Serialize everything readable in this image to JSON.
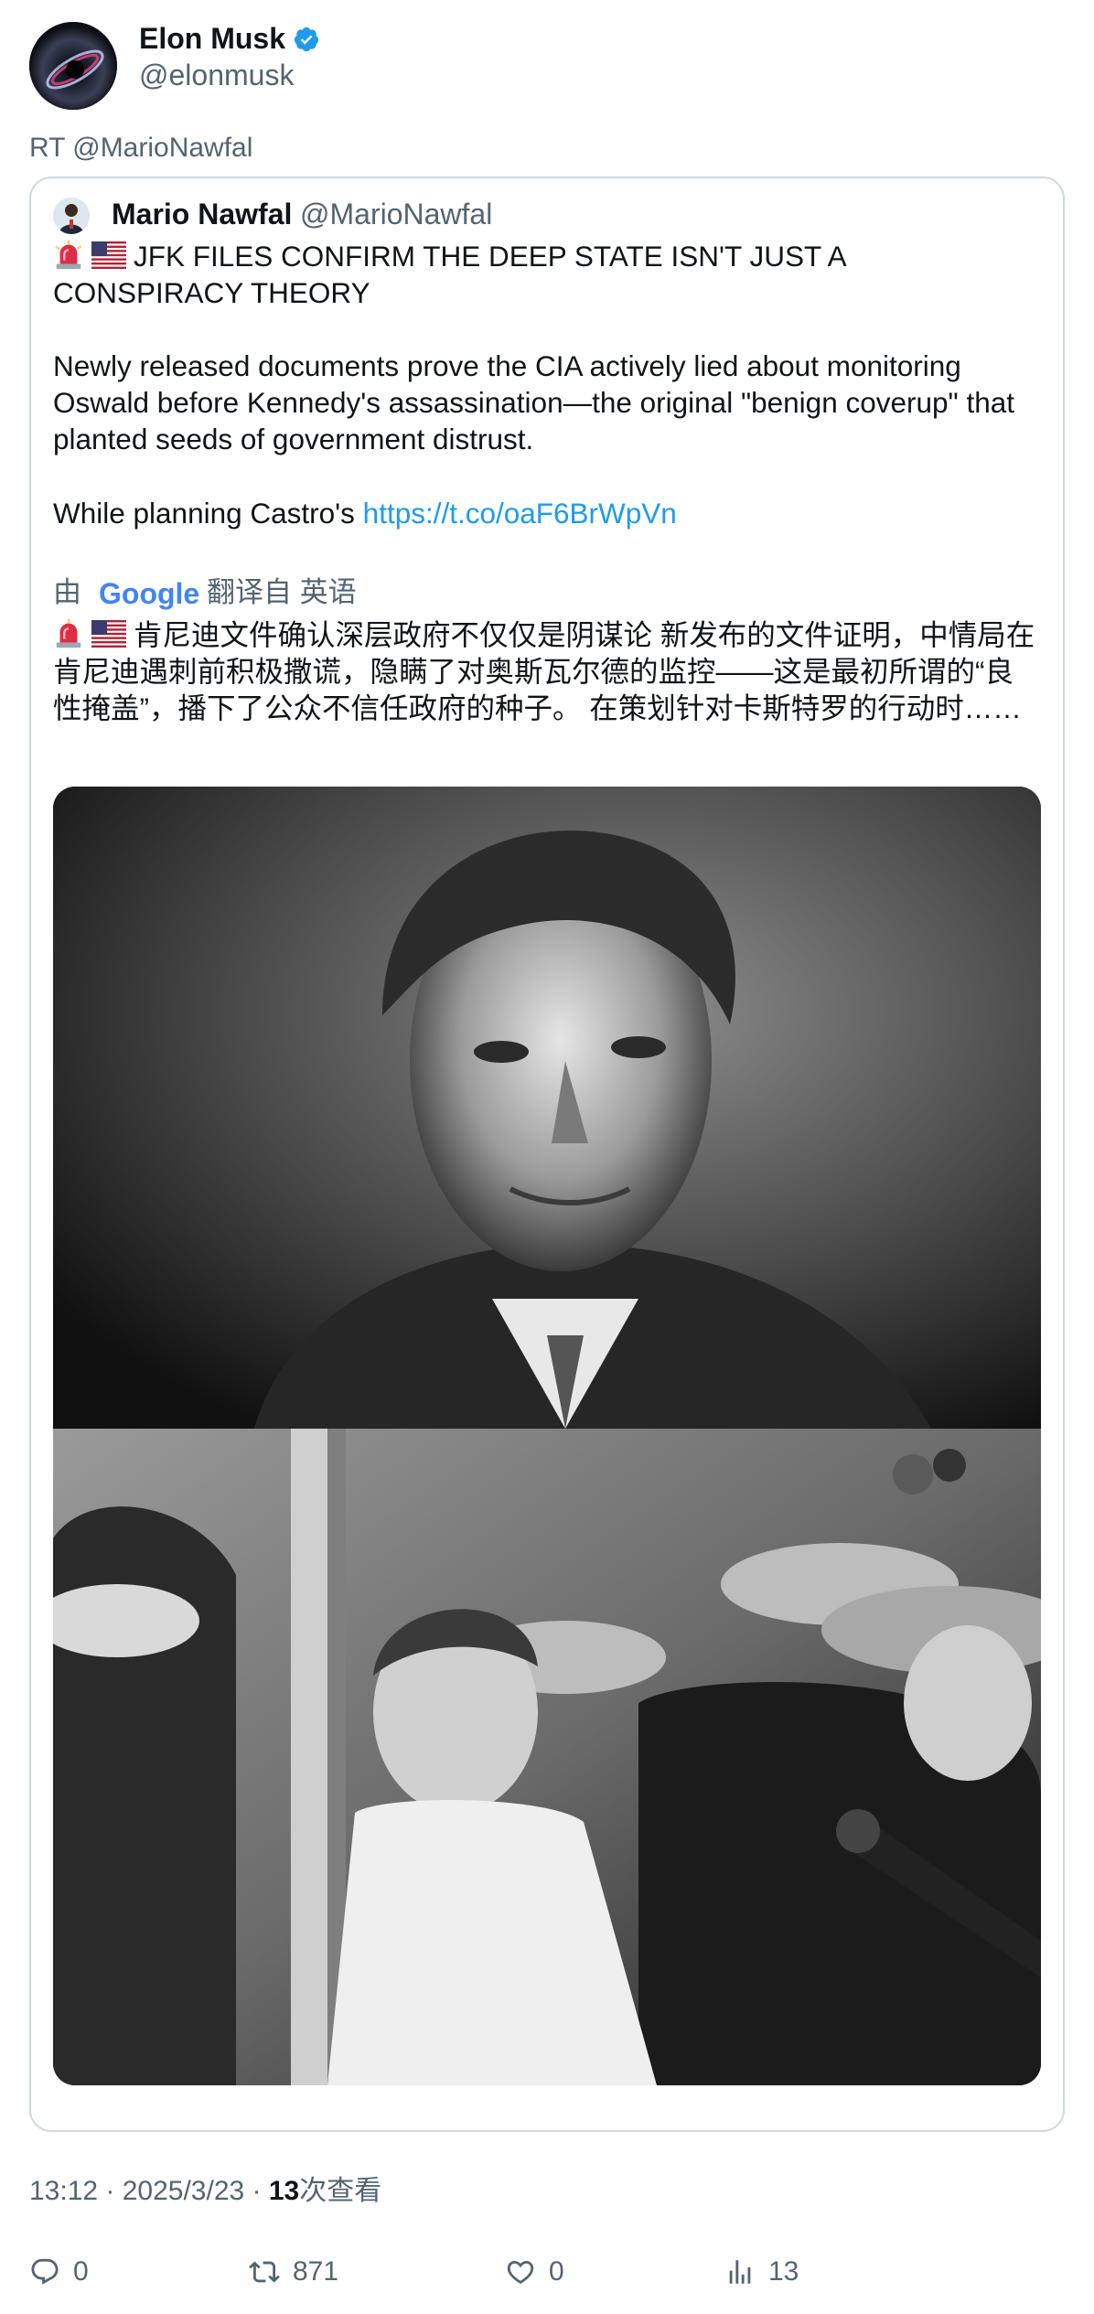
{
  "author": {
    "name": "Elon Musk",
    "handle": "@elonmusk",
    "verified_icon": "verified-badge-icon",
    "avatar_icon": "black-hole-avatar"
  },
  "retweet_label": "RT @MarioNawfal",
  "quoted": {
    "name": "Mario Nawfal",
    "handle": "@MarioNawfal",
    "headline": "JFK FILES CONFIRM THE DEEP STATE ISN'T JUST A CONSPIRACY THEORY",
    "body": "Newly released documents prove the CIA actively lied about monitoring Oswald before Kennedy's assassination—the original \"benign coverup\" that planted seeds of government distrust.",
    "tail_text": "While planning Castro's ",
    "link_text": "https://t.co/oaF6BrWpVn",
    "translate_by": "由",
    "google_label": "Google",
    "translated_from": "翻译自 英语",
    "translation": "肯尼迪文件确认深层政府不仅仅是阴谋论 新发布的文件证明，中情局在肯尼迪遇刺前积极撒谎，隐瞒了对奥斯瓦尔德的监控——这是最初所谓的“良性掩盖”，播下了公众不信任政府的种子。 在策划针对卡斯特罗的行动时……"
  },
  "meta": {
    "time": "13:12 · 2025/3/23 · ",
    "views_count": "13",
    "views_label": "次查看"
  },
  "actions": {
    "reply": "0",
    "retweet": "871",
    "like": "0",
    "views": "13"
  },
  "colors": {
    "link": "#1d9bf0",
    "secondary": "#536471",
    "border": "#cfd9de"
  }
}
